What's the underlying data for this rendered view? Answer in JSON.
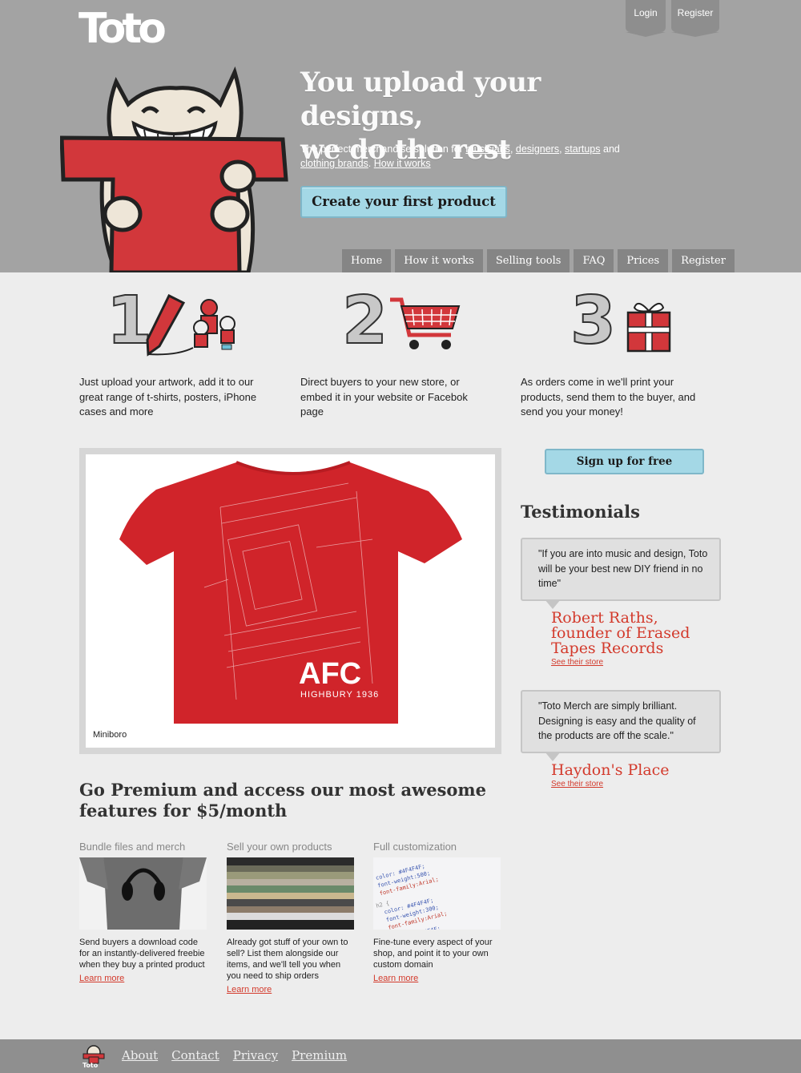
{
  "header": {
    "logo_text": "Toto",
    "auth": {
      "login": "Login",
      "register": "Register"
    },
    "hero_title_line1": "You upload your designs,",
    "hero_title_line2": "we do the rest",
    "hero_sub": {
      "prefix": "The perfect merchandise solution for ",
      "link_musicians": "musicians",
      "sep1": ", ",
      "link_designers": "designers",
      "sep2": ", ",
      "link_startups": "startups",
      "sep3": " and ",
      "link_clothing": "clothing brands",
      "sep4": ". ",
      "link_how": "How it works"
    },
    "cta_label": "Create your first product",
    "nav": [
      "Home",
      "How it works",
      "Selling tools",
      "FAQ",
      "Prices",
      "Register"
    ]
  },
  "steps": [
    {
      "number": "1",
      "text": "Just upload your artwork, add it to our great range of t-shirts, posters, iPhone cases and more"
    },
    {
      "number": "2",
      "text": "Direct buyers to your new store, or embed it in your website or Facebok page"
    },
    {
      "number": "3",
      "text": "As orders come in we'll print your products, send them to the buyer, and send you your money!"
    }
  ],
  "featured": {
    "caption": "Miniboro",
    "shirt_text_main": "AFC",
    "shirt_text_sub": "HIGHBURY 1936"
  },
  "sidebar": {
    "signup_label": "Sign up for free",
    "testimonials_heading": "Testimonials",
    "testimonials": [
      {
        "quote": "\"If you are into music and design, Toto will be your best new DIY friend in no time\"",
        "author": "Robert Raths, founder of Erased Tapes Records",
        "link": "See their store"
      },
      {
        "quote": "\"Toto Merch are simply brilliant. Designing is easy and the quality of the products are off the scale.\"",
        "author": "Haydon's Place",
        "link": "See their store"
      }
    ]
  },
  "premium": {
    "heading": "Go Premium and access our most awesome features for $5/month",
    "columns": [
      {
        "title": "Bundle files and merch",
        "desc": "Send buyers a download code for an instantly-delivered freebie when they buy a printed product",
        "more": "Learn more"
      },
      {
        "title": "Sell your own products",
        "desc": "Already got stuff of your own to sell? List them alongside our items, and we'll tell you when you need to ship orders",
        "more": "Learn more"
      },
      {
        "title": "Full customization",
        "desc": "Fine-tune every aspect of your shop, and point it to your own custom domain",
        "more": "Learn more"
      }
    ]
  },
  "footer": {
    "logo_text": "Toto",
    "links": [
      "About",
      "Contact",
      "Privacy",
      "Premium"
    ]
  },
  "colors": {
    "header_bg": "#a3a3a3",
    "page_bg": "#ededed",
    "accent_red": "#d33a2c",
    "cta_blue": "#a4d8e6",
    "nav_bg": "#858585",
    "footer_bg": "#8f8f8f"
  }
}
